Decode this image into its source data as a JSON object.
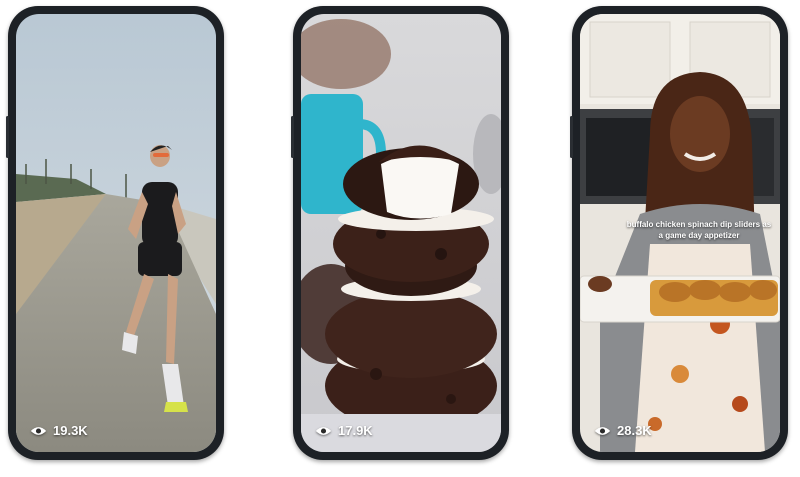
{
  "phones": [
    {
      "scene": "runner-on-beach-path",
      "views": "19.3K",
      "views_icon": "eye-icon"
    },
    {
      "scene": "stacked-chocolate-marshmallow-cookies",
      "views": "17.9K",
      "views_icon": "eye-icon"
    },
    {
      "scene": "woman-in-kitchen-holding-tray",
      "views": "28.3K",
      "views_icon": "eye-icon",
      "caption": "buffalo chicken spinach dip sliders as a game day appetizer"
    }
  ],
  "colors": {
    "frame": "#1d2126",
    "text": "#ffffff"
  }
}
